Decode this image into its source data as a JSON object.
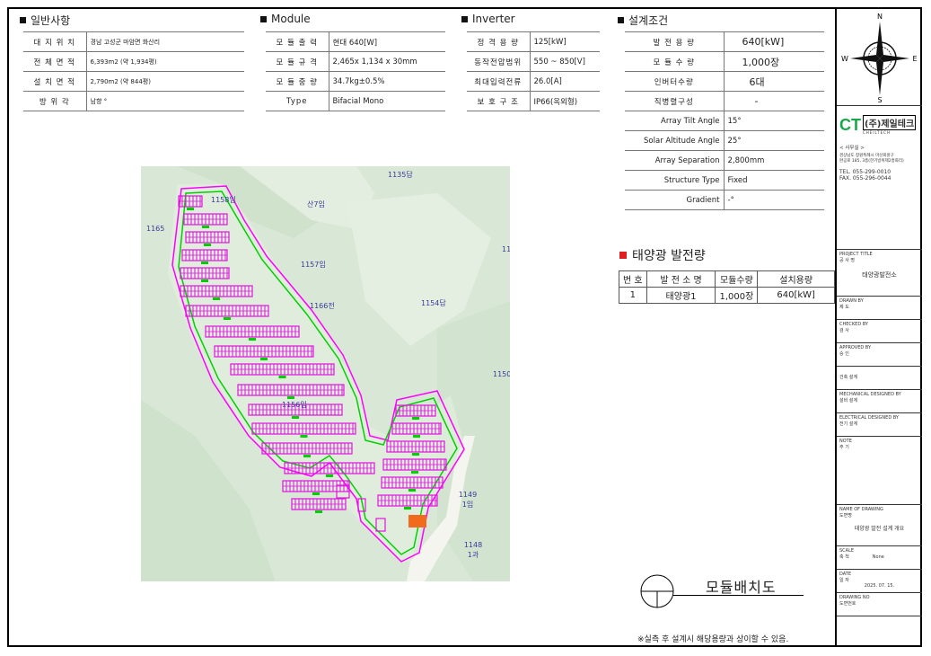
{
  "general": {
    "title": "일반사항",
    "rows": [
      {
        "label": "대 지 위 치",
        "value": "경남 고성군 마암면 화산리"
      },
      {
        "label": "전 체 면 적",
        "value": "6,393m2 (약 1,934평)"
      },
      {
        "label": "설 치 면 적",
        "value": "2,790m2 (약 844평)"
      },
      {
        "label": "방 위 각",
        "value": "남향 °"
      }
    ]
  },
  "module": {
    "title": "Module",
    "rows": [
      {
        "label": "모 듈 출 력",
        "value": "현대 640[W]"
      },
      {
        "label": "모 듈 규 격",
        "value": "2,465x 1,134 x 30mm"
      },
      {
        "label": "모 듈 중 량",
        "value": "34.7kg±0.5%"
      },
      {
        "label": "Type",
        "value": "Bifacial Mono"
      }
    ]
  },
  "inverter": {
    "title": "Inverter",
    "rows": [
      {
        "label": "정 격 용 량",
        "value": "125[kW]"
      },
      {
        "label": "동작전압범위",
        "value": "550 ~ 850[V]"
      },
      {
        "label": "최대입력전류",
        "value": "26.0[A]"
      },
      {
        "label": "보 호 구 조",
        "value": "IP66(옥외형)"
      }
    ]
  },
  "design": {
    "title": "설계조건",
    "rows": [
      {
        "label": "발 전 용 량",
        "value": "640[kW]"
      },
      {
        "label": "모 듈 수 량",
        "value": "1,000장"
      },
      {
        "label": "인버터수량",
        "value": "6대"
      },
      {
        "label": "직병렬구성",
        "value": "-"
      },
      {
        "label": "Array Tilt Angle",
        "value": "15°"
      },
      {
        "label": "Solar Altitude Angle",
        "value": "25°"
      },
      {
        "label": "Array Separation",
        "value": "2,800mm"
      },
      {
        "label": "Structure Type",
        "value": "Fixed"
      },
      {
        "label": "Gradient",
        "value": "-°"
      }
    ]
  },
  "plant": {
    "title": "태양광 발전량",
    "headers": [
      "번 호",
      "발 전 소 명",
      "모듈수량",
      "설치용량"
    ],
    "rows": [
      [
        "1",
        "태양광1",
        "1,000장",
        "640[kW]"
      ]
    ]
  },
  "map_labels": {
    "l1158": "1158임",
    "l1165": "1165",
    "l_san7": "산7임",
    "l1135": "1135답",
    "l1157": "1157임",
    "l1166": "1166전",
    "l1154": "1154답",
    "l11": "11",
    "l1150": "1150",
    "l1156": "1156임",
    "l1149": "1149\n1임",
    "l1148": "1148\n1과"
  },
  "layout_title": "모듈배치도",
  "note": "※실측 후 설계시 해당용량과 상이할 수 있음.",
  "compass": {
    "n": "N",
    "s": "S",
    "e": "E",
    "w": "W"
  },
  "company": {
    "logo_text": "CT",
    "name": "(주)제일테크",
    "en": "CHEILTECH",
    "office_label": "< 사무실 >",
    "addr1": "경상남도 창원특례시 마산회원구",
    "addr2": "완공로 185, 3층(한기방위제2흥화리)",
    "tel": "TEL. 055-299-0010",
    "fax": "FAX. 055-296-0044"
  },
  "title_block": {
    "project_title_en": "PROJECT TITLE",
    "project_title_ko": "공 사 명",
    "project_name": "태양광발전소",
    "drawn_en": "DRAWN BY",
    "drawn_ko": "제 도",
    "checked_en": "CHECKED BY",
    "checked_ko": "검 사",
    "approved_en": "APPROVED BY",
    "approved_ko": "승 인",
    "arch": "건축 설계",
    "mech_en": "MECHANICAL DESIGNED BY",
    "mech_ko": "설비 설계",
    "elec_en": "ELECTRICAL DESIGNED BY",
    "elec_ko": "전기 설계",
    "note_en": "NOTE",
    "note_ko": "주 기",
    "drawing_name_en": "NAME OF DRAWING",
    "drawing_name_ko": "도면명",
    "drawing_name": "태양광 발전 설계 개요",
    "scale_en": "SCALE",
    "scale_ko": "축 척",
    "scale": "None",
    "date_en": "DATE",
    "date_ko": "일 자",
    "date": "2025. 07. 15.",
    "no_en": "DRAWING NO",
    "no_ko": "도면번호"
  },
  "colors": {
    "module": "#e014e0",
    "fence": "#00d000",
    "boundary": "#ff00ff",
    "inverter": "#f26a1b"
  }
}
